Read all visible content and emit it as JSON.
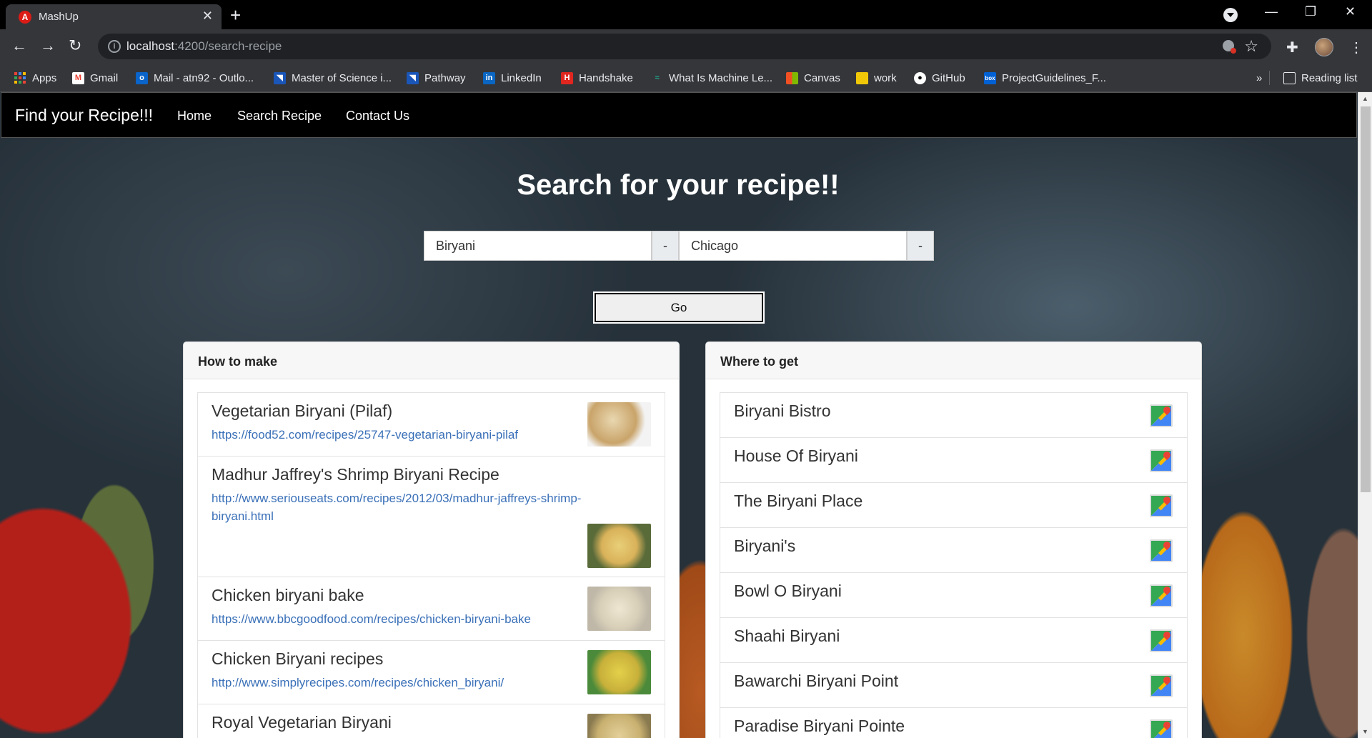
{
  "browser": {
    "tab_title": "MashUp",
    "tab_favicon": "A",
    "url_host": "localhost",
    "url_path": ":4200/search-recipe",
    "bookmarks": [
      {
        "label": "Apps",
        "icon": "apps-grid-icon"
      },
      {
        "label": "Gmail",
        "icon": "gmail-icon",
        "color": "#ea4335",
        "glyph": "M"
      },
      {
        "label": "Mail - atn92 - Outlo...",
        "icon": "outlook-icon",
        "color": "#0a64c9",
        "glyph": "o"
      },
      {
        "label": "Master of Science i...",
        "icon": "flag-icon",
        "color": "#1a56b8",
        "glyph": "◥"
      },
      {
        "label": "Pathway",
        "icon": "pathway-icon",
        "color": "#1a56b8",
        "glyph": "◥"
      },
      {
        "label": "LinkedIn",
        "icon": "linkedin-icon",
        "color": "#0a66c2",
        "glyph": "in"
      },
      {
        "label": "Handshake",
        "icon": "handshake-icon",
        "color": "#e0261f",
        "glyph": "H"
      },
      {
        "label": "What Is Machine Le...",
        "icon": "ml-icon",
        "color": "#1fa38b",
        "glyph": "≈"
      },
      {
        "label": "Canvas",
        "icon": "windows-icon",
        "color": "#f25022",
        "glyph": "▦"
      },
      {
        "label": "work",
        "icon": "folder-icon",
        "color": "#f0c808",
        "glyph": ""
      },
      {
        "label": "GitHub",
        "icon": "github-icon",
        "color": "#ffffff",
        "glyph": "●"
      },
      {
        "label": "ProjectGuidelines_F...",
        "icon": "box-icon",
        "color": "#0061d5",
        "glyph": "box"
      }
    ],
    "overflow_label": "»",
    "reading_list_label": "Reading list"
  },
  "navbar": {
    "brand": "Find your Recipe!!!",
    "links": [
      "Home",
      "Search Recipe",
      "Contact Us"
    ]
  },
  "search": {
    "heading": "Search for your recipe!!",
    "recipe_value": "Biryani",
    "location_value": "Chicago",
    "addon_label": "-",
    "go_label": "Go"
  },
  "how_to_make": {
    "title": "How to make",
    "recipes": [
      {
        "title": "Vegetarian Biryani (Pilaf)",
        "url": "https://food52.com/recipes/25747-vegetarian-biryani-pilaf",
        "thumb_color": "#c9a46a"
      },
      {
        "title": "Madhur Jaffrey's Shrimp Biryani Recipe",
        "url": "http://www.seriouseats.com/recipes/2012/03/madhur-jaffreys-shrimp-biryani.html",
        "thumb_color": "#d9b25a"
      },
      {
        "title": "Chicken biryani bake",
        "url": "https://www.bbcgoodfood.com/recipes/chicken-biryani-bake",
        "thumb_color": "#d8cfb8"
      },
      {
        "title": "Chicken Biryani recipes",
        "url": "http://www.simplyrecipes.com/recipes/chicken_biryani/",
        "thumb_color": "#c8b03a"
      },
      {
        "title": "Royal Vegetarian Biryani",
        "url": "",
        "thumb_color": "#c8b070"
      }
    ]
  },
  "where_to_get": {
    "title": "Where to get",
    "places": [
      "Biryani Bistro",
      "House Of Biryani",
      "The Biryani Place",
      "Biryani's",
      "Bowl O Biryani",
      "Shaahi Biryani",
      "Bawarchi Biryani Point",
      "Paradise Biryani Pointe"
    ]
  }
}
